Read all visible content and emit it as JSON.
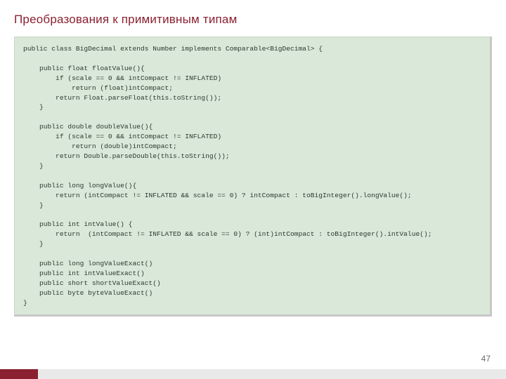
{
  "slide": {
    "title": "Преобразования к примитивным типам",
    "page_number": "47"
  },
  "code": {
    "lines": [
      "public class BigDecimal extends Number implements Comparable<BigDecimal> {",
      "",
      "    public float floatValue(){",
      "        if (scale == 0 && intCompact != INFLATED)",
      "            return (float)intCompact;",
      "        return Float.parseFloat(this.toString());",
      "    }",
      "",
      "    public double doubleValue(){",
      "        if (scale == 0 && intCompact != INFLATED)",
      "            return (double)intCompact;",
      "        return Double.parseDouble(this.toString());",
      "    }",
      "",
      "    public long longValue(){",
      "        return (intCompact != INFLATED && scale == 0) ? intCompact : toBigInteger().longValue();",
      "    }",
      "",
      "    public int intValue() {",
      "        return  (intCompact != INFLATED && scale == 0) ? (int)intCompact : toBigInteger().intValue();",
      "    }",
      "",
      "    public long longValueExact()",
      "    public int intValueExact()",
      "    public short shortValueExact()",
      "    public byte byteValueExact()",
      "}"
    ]
  }
}
